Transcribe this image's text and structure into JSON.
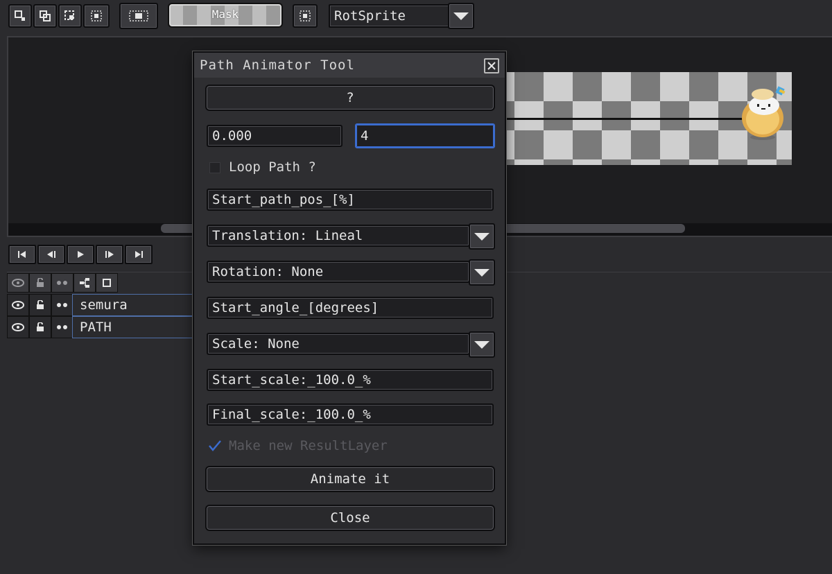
{
  "toolbar": {
    "icons": [
      "select-rect-icon",
      "select-copy-icon",
      "select-transform-icon",
      "select-grid-icon",
      "select-all-icon",
      "grid-dots-icon"
    ],
    "mask_label": "Mask",
    "rotation_algorithm": "RotSprite"
  },
  "playback": {
    "buttons": [
      "first-frame-icon",
      "prev-frame-icon",
      "play-icon",
      "next-frame-icon",
      "last-frame-icon"
    ]
  },
  "layers": {
    "header_icons": [
      "eye-icon",
      "lock-icon",
      "onion-icon",
      "hierarchy-icon",
      "square-icon"
    ],
    "rows": [
      {
        "name": "semura"
      },
      {
        "name": "PATH"
      }
    ]
  },
  "dialog": {
    "title": "Path Animator Tool",
    "help_label": "?",
    "offset_value": "0.000",
    "frames_value": "4",
    "loop_label": "Loop Path ?",
    "start_path_pos": "Start_path_pos_[%]",
    "translation": "Translation: Lineal",
    "rotation": "Rotation: None",
    "start_angle": "Start_angle_[degrees]",
    "scale": "Scale: None",
    "start_scale": "Start_scale:_100.0_%",
    "final_scale": "Final_scale:_100.0_%",
    "make_layer_label": "Make new ResultLayer",
    "animate_label": "Animate it",
    "close_label": "Close"
  },
  "colors": {
    "accent": "#3b6ccf",
    "background": "#2b2b2e"
  }
}
